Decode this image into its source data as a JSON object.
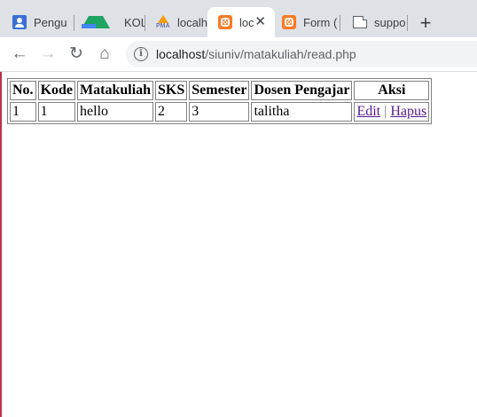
{
  "browser": {
    "tabs": [
      {
        "title": "Pengu",
        "icon": "user-icon"
      },
      {
        "title": "KOLAB",
        "icon": "drive-icon"
      },
      {
        "title": "localhc",
        "icon": "phpmyadmin-icon"
      },
      {
        "title": "loc",
        "icon": "xampp-icon",
        "active": true
      },
      {
        "title": "Form (",
        "icon": "xampp-icon"
      },
      {
        "title": "suppo",
        "icon": "document-icon"
      }
    ],
    "new_tab_label": "+",
    "url_host": "localhost",
    "url_path": "/siuniv/matakuliah/read.php"
  },
  "table": {
    "headers": {
      "no": "No.",
      "kode": "Kode",
      "matakuliah": "Matakuliah",
      "sks": "SKS",
      "semester": "Semester",
      "dosen": "Dosen Pengajar",
      "aksi": "Aksi"
    },
    "rows": [
      {
        "no": "1",
        "kode": "1",
        "matakuliah": "hello",
        "sks": "2",
        "semester": "3",
        "dosen": "talitha",
        "edit_label": "Edit",
        "separator": "|",
        "hapus_label": "Hapus"
      }
    ]
  },
  "colors": {
    "tabstrip": "#dee1e6",
    "link_visited": "#551a8b",
    "xampp_orange": "#fb7a24"
  }
}
